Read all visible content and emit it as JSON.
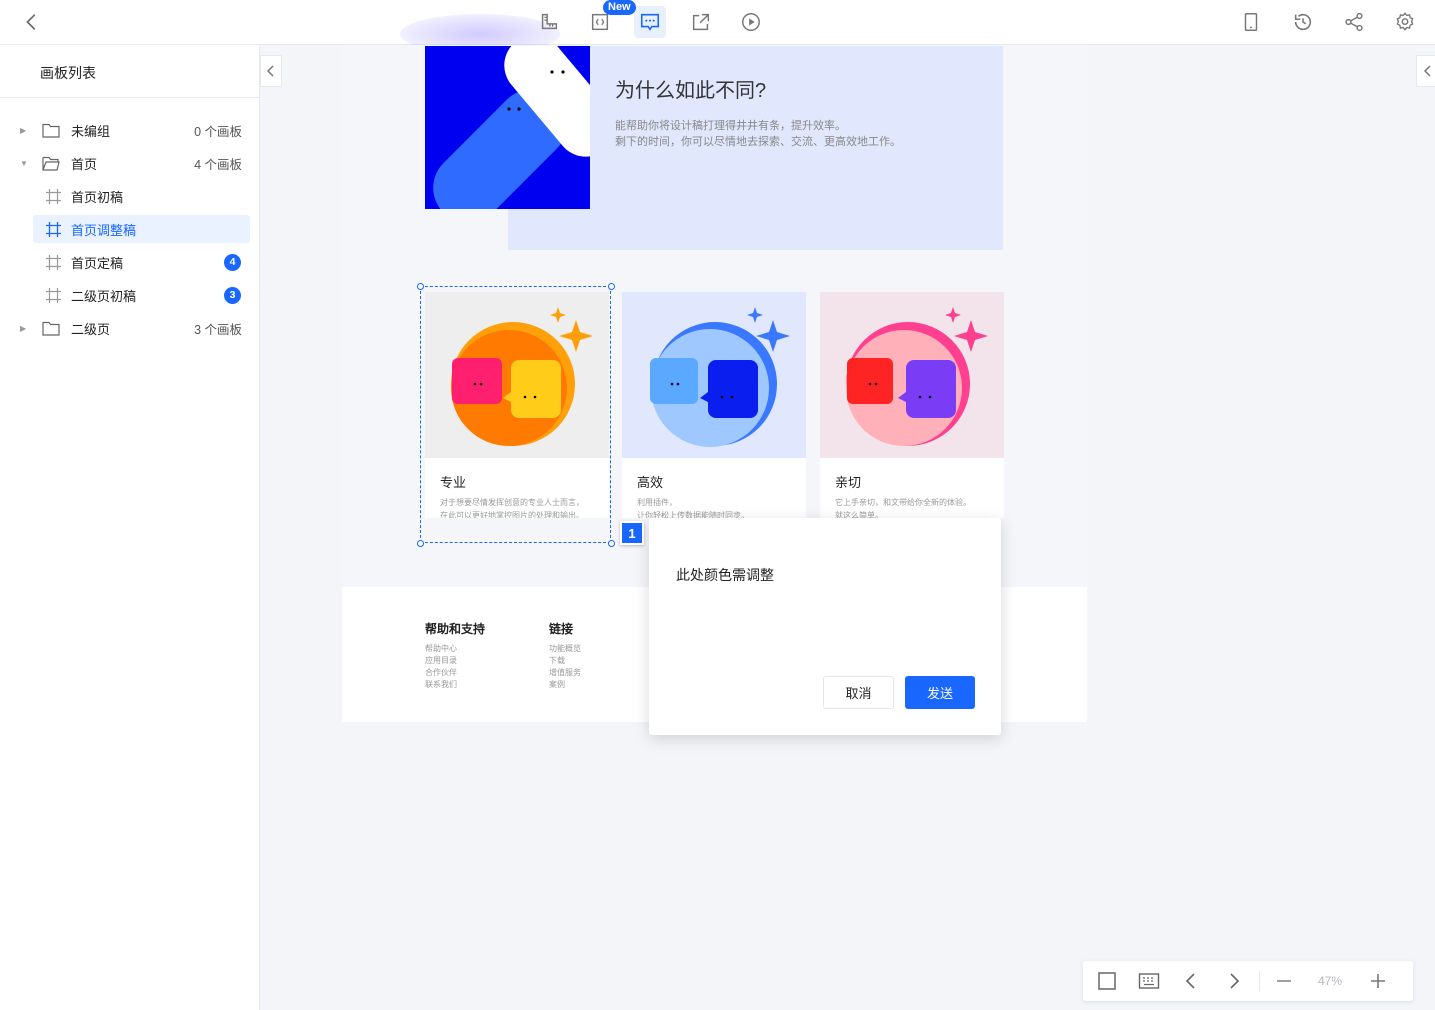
{
  "toolbar": {
    "new_badge": "New"
  },
  "sidebar": {
    "title": "画板列表",
    "items": [
      {
        "label": "未编组",
        "count": "0 个画板"
      },
      {
        "label": "首页",
        "count": "4 个画板"
      },
      {
        "label": "首页初稿"
      },
      {
        "label": "首页调整稿"
      },
      {
        "label": "首页定稿",
        "badge": "4"
      },
      {
        "label": "二级页初稿",
        "badge": "3"
      },
      {
        "label": "二级页",
        "count": "3 个画板"
      }
    ]
  },
  "board": {
    "hero_title": "为什么如此不同?",
    "hero_desc_1": "能帮助你将设计稿打理得井井有条，提升效率。",
    "hero_desc_2": "剩下的时间，你可以尽情地去探索、交流、更高效地工作。",
    "cards": [
      {
        "title": "专业",
        "desc_1": "对于想要尽情发挥创意的专业人士而言，",
        "desc_2": "在此可以更好地掌控图片的处理和输出。"
      },
      {
        "title": "高效",
        "desc_1": "利用插件，",
        "desc_2": "让你轻松上传数据能随时同步。"
      },
      {
        "title": "亲切",
        "desc_1": "它上手亲切，和文带给你全新的体验。",
        "desc_2": "就这么简单。"
      }
    ],
    "footer": {
      "col1_title": "帮助和支持",
      "col1_items": [
        "帮助中心",
        "应用目录",
        "合作伙伴",
        "联系我们"
      ],
      "col2_title": "链接",
      "col2_items": [
        "功能概览",
        "下载",
        "增值服务",
        "案例"
      ]
    }
  },
  "comment": {
    "pin_number": "1",
    "text": "此处颜色需调整",
    "cancel_label": "取消",
    "send_label": "发送"
  },
  "zoom": {
    "value": "47%"
  },
  "colors": {
    "accent": "#1967ff",
    "hero_blue": "#0000f0",
    "hero_bg": "#e1e8fd"
  }
}
